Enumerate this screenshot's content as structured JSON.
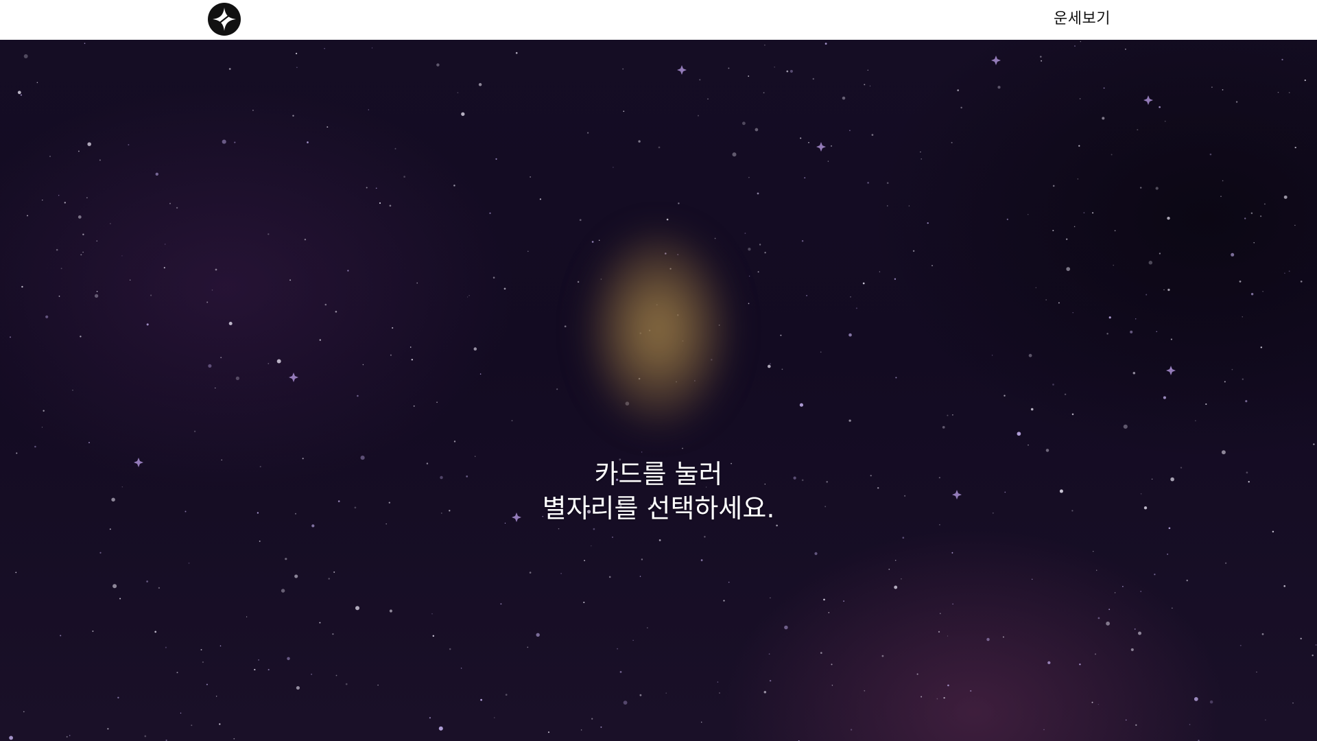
{
  "navbar": {
    "logo_icon": "four-point-star-logo-icon",
    "link_label": "운세보기"
  },
  "hero": {
    "card_icon": "glowing-card",
    "instruction_line1": "카드를 눌러",
    "instruction_line2": "별자리를 선택하세요."
  },
  "colors": {
    "navbar_bg": "#ffffff",
    "sky_bg": "#150d24",
    "card_glow": "#96784a",
    "text": "#ffffff"
  }
}
